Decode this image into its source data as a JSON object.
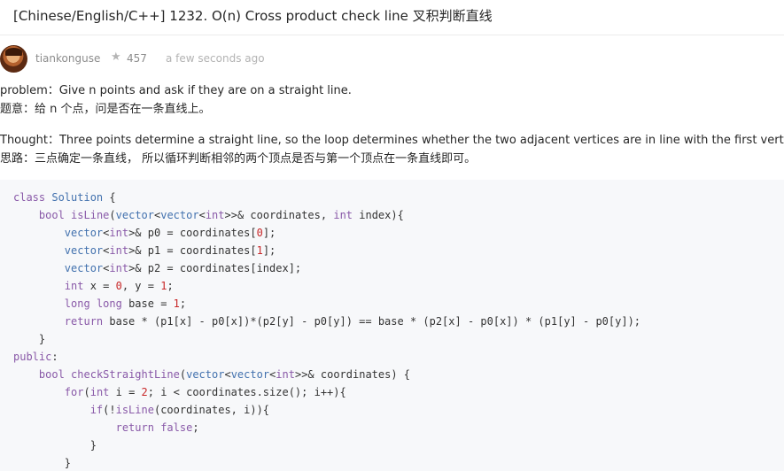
{
  "post": {
    "title": "[Chinese/English/C++] 1232. O(n) Cross product check line 叉积判断直线"
  },
  "author": {
    "username": "tiankonguse",
    "reputation": "457",
    "time": "a few seconds ago",
    "star_icon": "★"
  },
  "content": {
    "problem_en": "problem：Give n points and ask if they are on a straight line.",
    "problem_zh": "题意：给 n 个点，问是否在一条直线上。",
    "thought_en": "Thought：Three points determine a straight line, so the loop determines whether the two adjacent vertices are in line with the first vertex.",
    "thought_zh": "思路：三点确定一条直线， 所以循环判断相邻的两个顶点是否与第一个顶点在一条直线即可。"
  },
  "code": {
    "lines": [
      "class Solution {",
      "    bool isLine(vector<vector<int>>& coordinates, int index){",
      "        vector<int>& p0 = coordinates[0];",
      "        vector<int>& p1 = coordinates[1];",
      "        vector<int>& p2 = coordinates[index];",
      "        int x = 0, y = 1;",
      "        long long base = 1;",
      "        return base * (p1[x] - p0[x])*(p2[y] - p0[y]) == base * (p2[x] - p0[x]) * (p1[y] - p0[y]);",
      "    }",
      "public:",
      "    bool checkStraightLine(vector<vector<int>>& coordinates) {",
      "        for(int i = 2; i < coordinates.size(); i++){",
      "            if(!isLine(coordinates, i)){",
      "                return false;",
      "            }",
      "        }"
    ]
  }
}
